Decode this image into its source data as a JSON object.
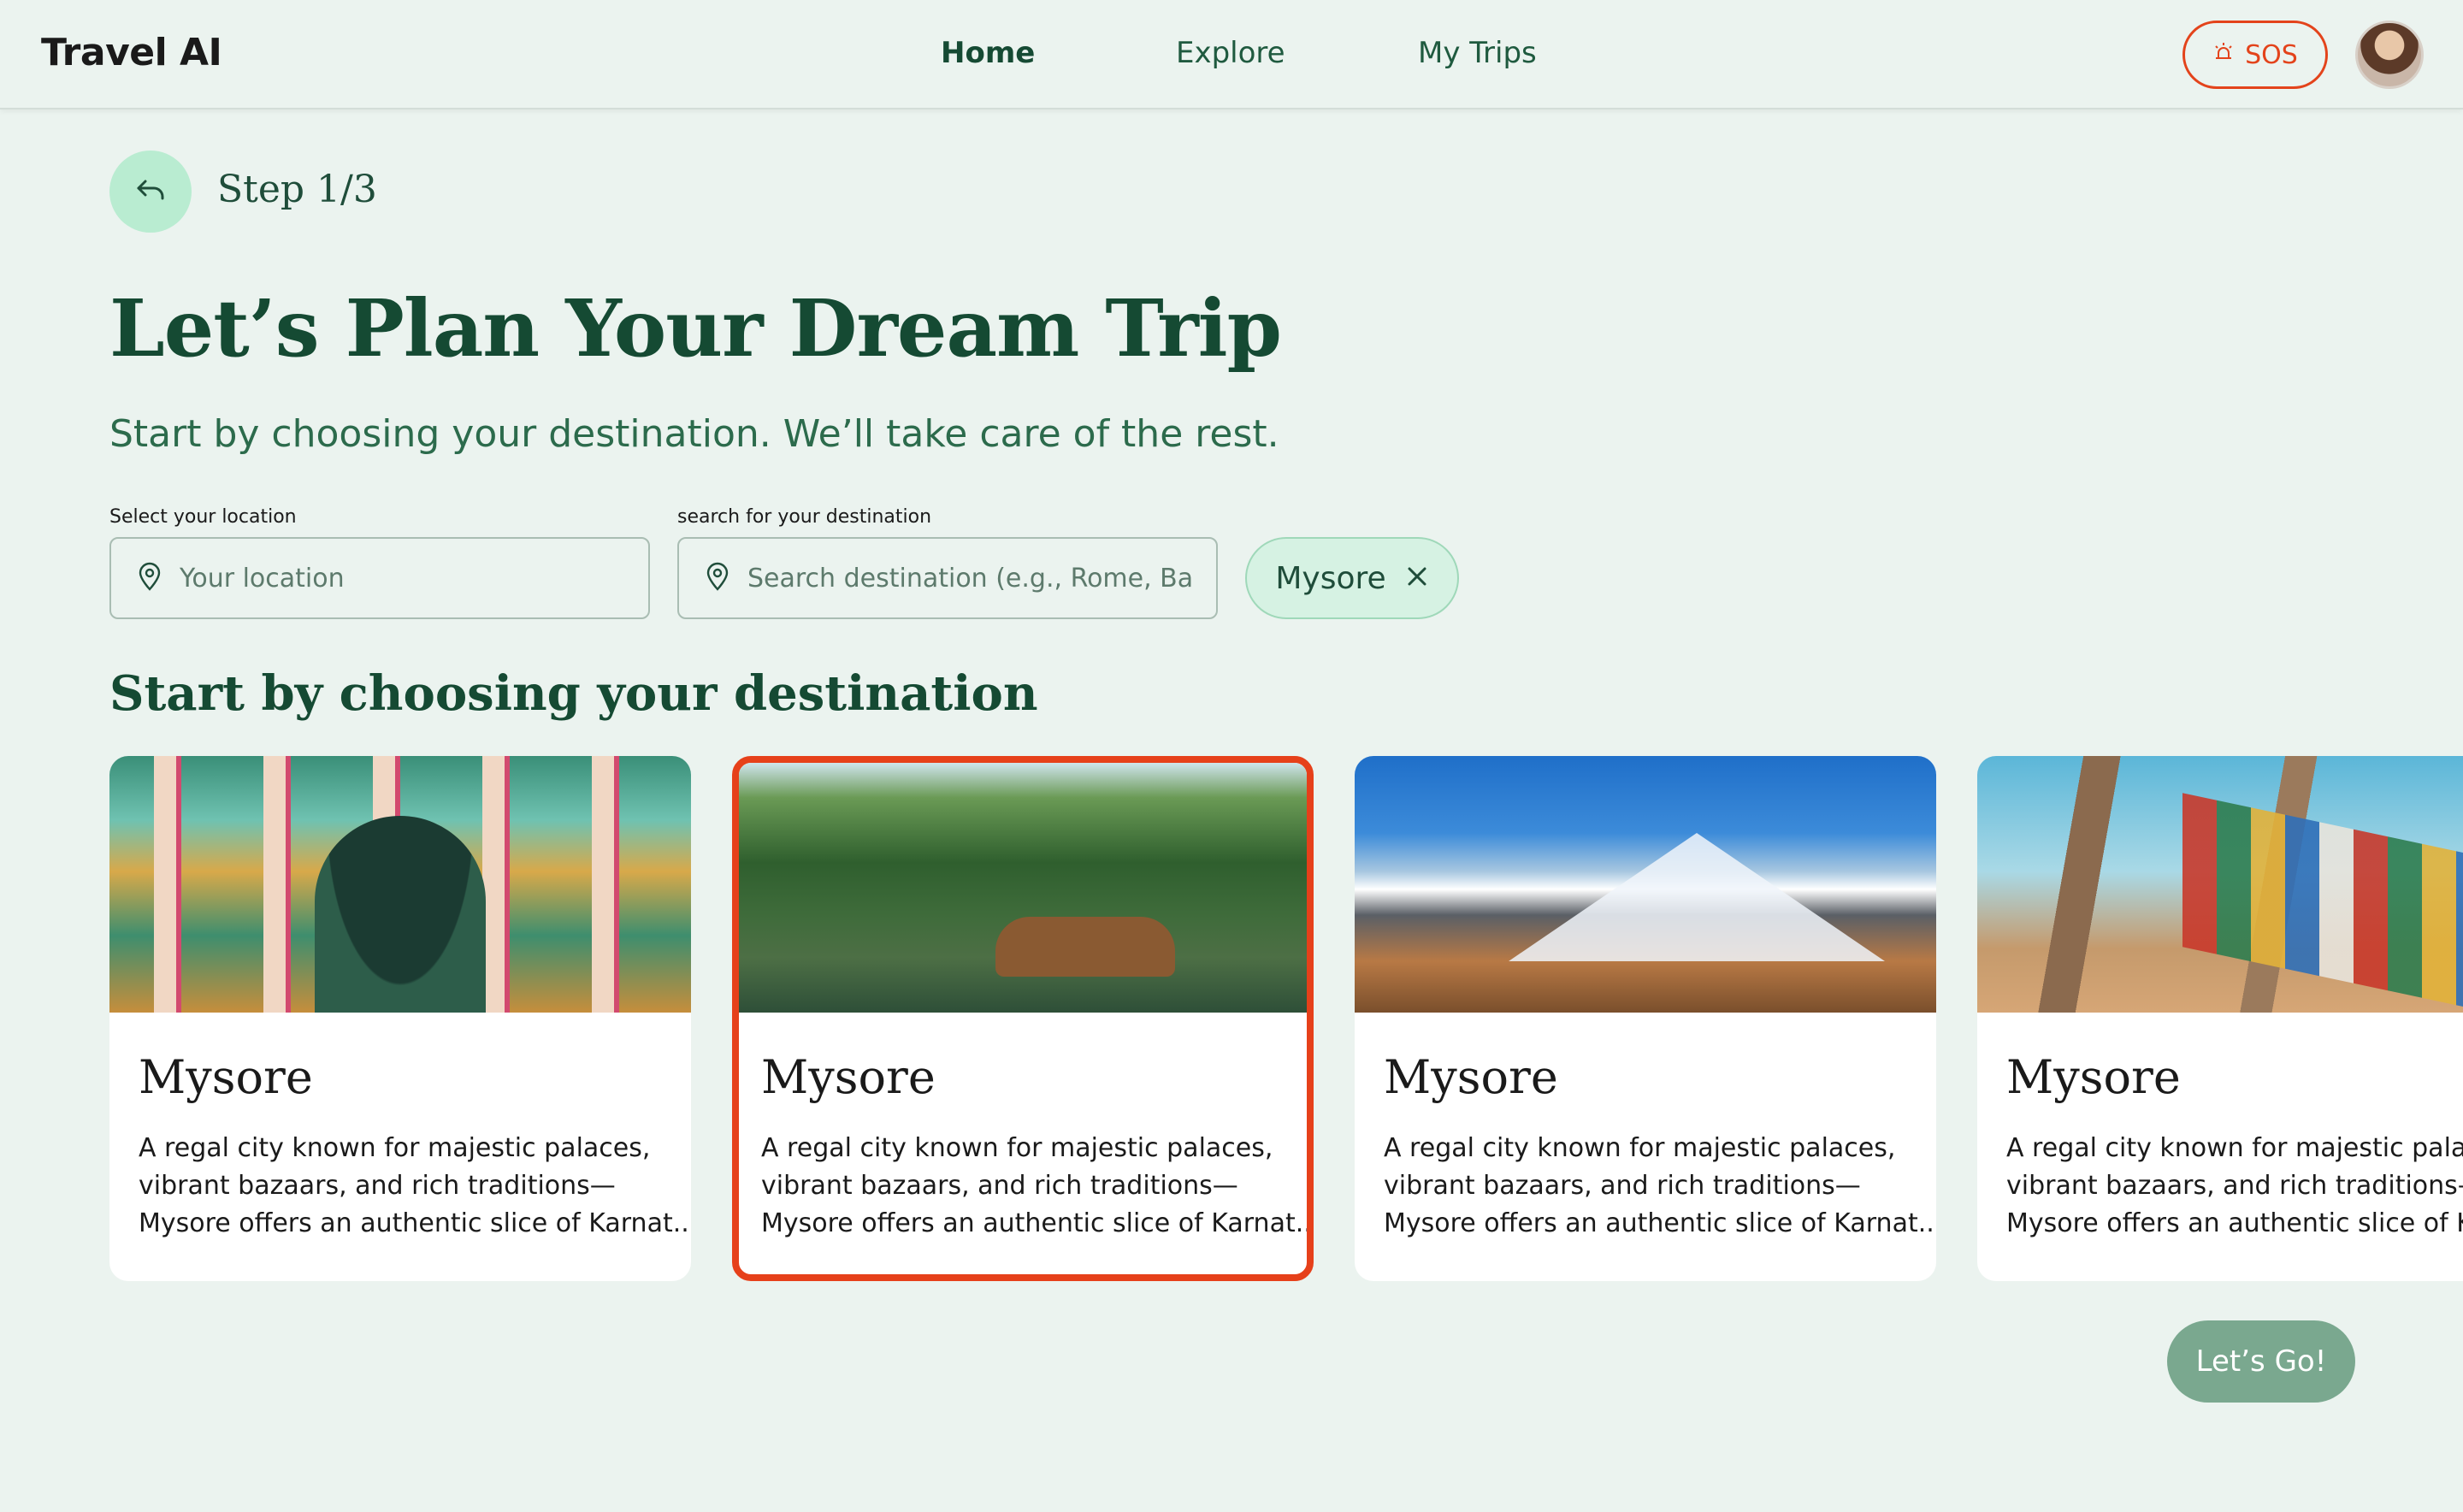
{
  "header": {
    "brand": "Travel AI",
    "nav": [
      {
        "label": "Home",
        "active": true
      },
      {
        "label": "Explore",
        "active": false
      },
      {
        "label": "My Trips",
        "active": false
      }
    ],
    "sos_label": "SOS"
  },
  "step": {
    "label": "Step 1/3"
  },
  "hero": {
    "title": "Let’s Plan Your Dream Trip",
    "subtitle": "Start by choosing your destination. We’ll take care of the rest."
  },
  "location": {
    "label": "Select your location",
    "placeholder": "Your location",
    "value": ""
  },
  "destination": {
    "label": "search for your destination",
    "placeholder": "Search destination (e.g., Rome, Ba...",
    "value": ""
  },
  "selected_chip": {
    "label": "Mysore"
  },
  "section_title": "Start by choosing your destination",
  "cards": [
    {
      "title": "Mysore",
      "desc_lines": [
        "A regal city known for majestic palaces,",
        "vibrant bazaars, and rich traditions—",
        "Mysore offers an authentic slice of Karnat..."
      ],
      "image": "palace-interior",
      "selected": false
    },
    {
      "title": "Mysore",
      "desc_lines": [
        "A regal city known for majestic palaces,",
        "vibrant bazaars, and rich traditions—",
        "Mysore offers an authentic slice of Karnat..."
      ],
      "image": "backwater-houseboat",
      "selected": true
    },
    {
      "title": "Mysore",
      "desc_lines": [
        "A regal city known for majestic palaces,",
        "vibrant bazaars, and rich traditions—",
        "Mysore offers an authentic slice of Karnat..."
      ],
      "image": "snowy-mountains",
      "selected": false
    },
    {
      "title": "Mysore",
      "desc_lines": [
        "A regal city known for majestic palace",
        "vibrant bazaars, and rich traditions—",
        "Mysore offers an authentic slice of Kar"
      ],
      "image": "prayer-flags",
      "selected": false
    }
  ],
  "cta": {
    "label": "Let’s Go!"
  },
  "colors": {
    "accent": "#154a33",
    "background": "#ebf3ef",
    "sos": "#e3431b",
    "selected_border": "#e6401a",
    "cta": "#7aa88f"
  }
}
